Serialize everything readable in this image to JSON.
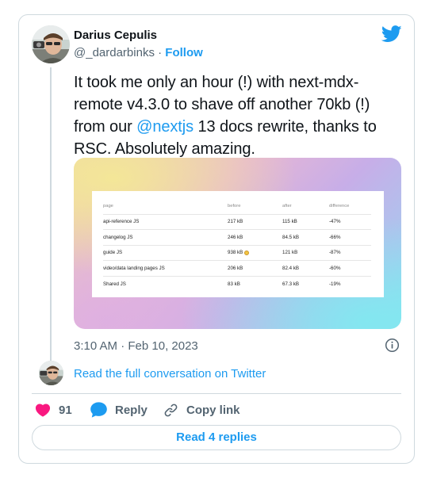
{
  "author": {
    "name": "Darius Cepulis",
    "handle": "@_dardarbinks",
    "separator": "·",
    "follow_label": "Follow"
  },
  "tweet": {
    "text_before": "It took me only an hour (!) with next-mdx-remote v4.3.0 to shave off another 70kb (!) from our ",
    "mention": "@nextjs",
    "text_after": " 13 docs rewrite, thanks to RSC. Absolutely amazing.",
    "timestamp": "3:10 AM · Feb 10, 2023"
  },
  "media_table": {
    "headers": [
      "page",
      "before",
      "after",
      "difference"
    ],
    "rows": [
      [
        "api-reference JS",
        "217 kB",
        "115 kB",
        "-47%"
      ],
      [
        "changelog JS",
        "246 kB",
        "84.5 kB",
        "-66%"
      ],
      [
        "guide JS",
        "938 kB",
        "121 kB",
        "-87%"
      ],
      [
        "video/data landing pages JS",
        "206 kB",
        "82.4 kB",
        "-60%"
      ],
      [
        "Shared JS",
        "83 kB",
        "67.3 kB",
        "-19%"
      ]
    ]
  },
  "conversation_link": "Read the full conversation on Twitter",
  "actions": {
    "like_count": "91",
    "reply_label": "Reply",
    "copy_link_label": "Copy link"
  },
  "read_replies_label": "Read 4 replies",
  "icons": {
    "brand": "twitter-bird-icon",
    "info": "info-icon",
    "like": "heart-icon",
    "reply": "speech-bubble-icon",
    "copy": "link-icon"
  },
  "colors": {
    "accent": "#1d9bf0",
    "like": "#f91880",
    "muted": "#536471",
    "text": "#0f1419",
    "border": "#cfd9de"
  }
}
